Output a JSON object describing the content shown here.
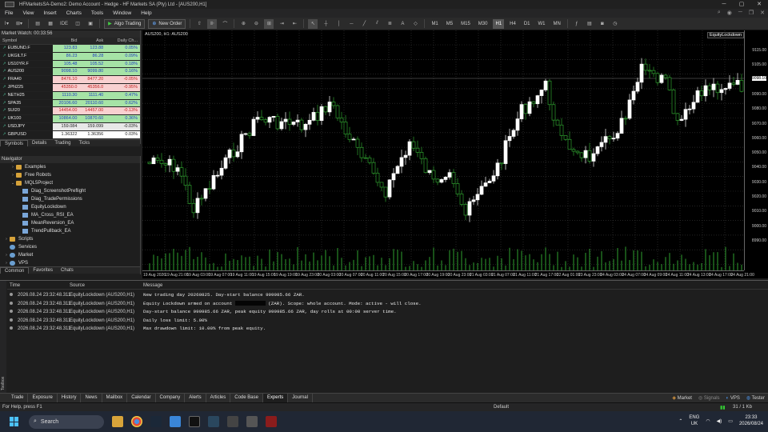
{
  "window": {
    "title": "HFMarketsSA-Demo2: Demo Account - Hedge - HF Markets SA (Pty) Ltd - [AUS200,H1]"
  },
  "menu": [
    "File",
    "View",
    "Insert",
    "Charts",
    "Tools",
    "Window",
    "Help"
  ],
  "toolbar": {
    "ide_label": "IDE",
    "algo_label": "Algo Trading",
    "new_order_label": "New Order",
    "timeframes": [
      "M1",
      "M5",
      "M15",
      "M30",
      "H1",
      "H4",
      "D1",
      "W1",
      "MN"
    ],
    "active_timeframe": "H1"
  },
  "market_watch": {
    "title": "Market Watch: 00:33:56",
    "columns": [
      "Symbol",
      "Bid",
      "Ask",
      "Daily Ch..."
    ],
    "rows": [
      {
        "symbol": "EUBUND.F",
        "bid": "123.83",
        "ask": "123.88",
        "change": "0.05%",
        "dir": "up"
      },
      {
        "symbol": "UKGILT.F",
        "bid": "86.23",
        "ask": "86.28",
        "change": "0.09%",
        "dir": "up"
      },
      {
        "symbol": "US10YR.F",
        "bid": "105.48",
        "ask": "105.52",
        "change": "0.18%",
        "dir": "up"
      },
      {
        "symbol": "AUS200",
        "bid": "9098.10",
        "ask": "9099.80",
        "change": "0.16%",
        "dir": "up"
      },
      {
        "symbol": "FRA40",
        "bid": "8476.10",
        "ask": "8477.20",
        "change": "-0.05%",
        "dir": "down"
      },
      {
        "symbol": "JPN225",
        "bid": "45350.0",
        "ask": "45356.0",
        "change": "-0.95%",
        "dir": "down"
      },
      {
        "symbol": "NETH25",
        "bid": "1110.30",
        "ask": "1111.40",
        "change": "0.47%",
        "dir": "up"
      },
      {
        "symbol": "SPA35",
        "bid": "20106.60",
        "ask": "20110.60",
        "change": "0.62%",
        "dir": "up"
      },
      {
        "symbol": "SUI20",
        "bid": "14454.00",
        "ask": "14457.00",
        "change": "-0.13%",
        "dir": "down"
      },
      {
        "symbol": "UK100",
        "bid": "10864.00",
        "ask": "10870.60",
        "change": "0.36%",
        "dir": "up"
      },
      {
        "symbol": "USDJPY",
        "bid": "159.084",
        "ask": "159.099",
        "change": "-0.03%",
        "dir": "neutral"
      },
      {
        "symbol": "GBPUSD",
        "bid": "1.36322",
        "ask": "1.36356",
        "change": "0.03%",
        "dir": "hl"
      }
    ],
    "tabs": [
      "Symbols",
      "Details",
      "Trading",
      "Ticks"
    ]
  },
  "navigator": {
    "title": "Navigator",
    "items": [
      {
        "label": "Examples",
        "level": 1,
        "type": "folder",
        "arrow": "›"
      },
      {
        "label": "Free Robots",
        "level": 1,
        "type": "folder",
        "arrow": "›"
      },
      {
        "label": "MQL5Project",
        "level": 1,
        "type": "folder",
        "arrow": "⌄"
      },
      {
        "label": "Diag_ScreenshotPreflight",
        "level": 2,
        "type": "file",
        "arrow": ""
      },
      {
        "label": "Diag_TradePermissions",
        "level": 2,
        "type": "file",
        "arrow": ""
      },
      {
        "label": "EquityLockdown",
        "level": 2,
        "type": "file",
        "arrow": ""
      },
      {
        "label": "MA_Cross_RSI_EA",
        "level": 2,
        "type": "file",
        "arrow": ""
      },
      {
        "label": "MeanReversion_EA",
        "level": 2,
        "type": "file",
        "arrow": ""
      },
      {
        "label": "TrendPullback_EA",
        "level": 2,
        "type": "file",
        "arrow": ""
      },
      {
        "label": "Scripts",
        "level": 0,
        "type": "folder",
        "arrow": "›"
      },
      {
        "label": "Services",
        "level": 0,
        "type": "gear",
        "arrow": ""
      },
      {
        "label": "Market",
        "level": 0,
        "type": "gear",
        "arrow": "›"
      },
      {
        "label": "VPS",
        "level": 0,
        "type": "gear",
        "arrow": "›"
      }
    ],
    "tabs": [
      "Common",
      "Favorites",
      "Chats"
    ]
  },
  "chart": {
    "symbol_label": "AUS200, H1: AUS200",
    "ea_label": "EquityLockdown",
    "price_labels": [
      "9115.00",
      "9105.00",
      "9098.10",
      "9090.00",
      "9080.00",
      "9070.00",
      "9060.00",
      "9050.00",
      "9040.00",
      "9030.00",
      "9020.00",
      "9010.00",
      "9000.00",
      "8990.00"
    ],
    "time_labels": [
      "19 Aug 2026",
      "19 Aug 21:00",
      "19 Aug 03:00",
      "19 Aug 07:00",
      "19 Aug 11:00",
      "19 Aug 15:00",
      "19 Aug 19:00",
      "19 Aug 23:00",
      "20 Aug 03:00",
      "20 Aug 07:00",
      "20 Aug 11:00",
      "20 Aug 15:00",
      "20 Aug 17:00",
      "20 Aug 19:00",
      "20 Aug 23:00",
      "21 Aug 03:00",
      "21 Aug 07:00",
      "21 Aug 11:00",
      "21 Aug 17:00",
      "22 Aug 01:00",
      "23 Aug 23:00",
      "24 Aug 03:00",
      "24 Aug 07:00",
      "24 Aug 09:00",
      "24 Aug 11:00",
      "24 Aug 13:00",
      "24 Aug 17:00",
      "24 Aug 21:00"
    ]
  },
  "toolbox": {
    "side_label": "Toolbox",
    "columns": [
      "Time",
      "Source",
      "Message"
    ],
    "rows": [
      {
        "time": "2026.08.24 23:32:48.311",
        "source": "EquityLockdown (AUS200,H1)",
        "message": "New trading day 20260825. Day-start balance 999985.66 ZAR.",
        "pre": "",
        "post": ""
      },
      {
        "time": "2026.08.24 23:32:48.311",
        "source": "EquityLockdown (AUS200,H1)",
        "message": "Equity Lockdown armed on account ",
        "pre": "",
        "post": " (ZAR). Scope: whole account. Mode: active - will close."
      },
      {
        "time": "2026.08.24 23:32:48.311",
        "source": "EquityLockdown (AUS200,H1)",
        "message": "  Day-start balance 999985.66 ZAR, peak equity 999985.66 ZAR, day rolls at 00:00 server time.",
        "pre": "",
        "post": ""
      },
      {
        "time": "2026.08.24 23:32:48.311",
        "source": "EquityLockdown (AUS200,H1)",
        "message": "  Daily loss limit: 5.00%",
        "pre": "",
        "post": ""
      },
      {
        "time": "2026.08.24 23:32:48.311",
        "source": "EquityLockdown (AUS200,H1)",
        "message": "  Max drawdown limit: 10.00% from peak equity.",
        "pre": "",
        "post": ""
      }
    ],
    "tabs": [
      "Trade",
      "Exposure",
      "History",
      "News",
      "Mailbox",
      "Calendar",
      "Company",
      "Alerts",
      "Articles",
      "Code Base",
      "Experts",
      "Journal"
    ],
    "active_tab": "Experts",
    "right": [
      "Market",
      "Signals",
      "VPS",
      "Tester"
    ]
  },
  "status": {
    "help": "For Help, press F1",
    "profile": "Default",
    "traffic": "31 / 1 Kb"
  },
  "taskbar": {
    "search_placeholder": "Search",
    "lang": "ENG",
    "region": "UK",
    "time": "23:33",
    "date": "2026/08/24"
  },
  "colors": {
    "up": "#ffffff",
    "down": "#2fa02f",
    "grid": "#3a3a3a",
    "volume": "#2fa02f"
  }
}
